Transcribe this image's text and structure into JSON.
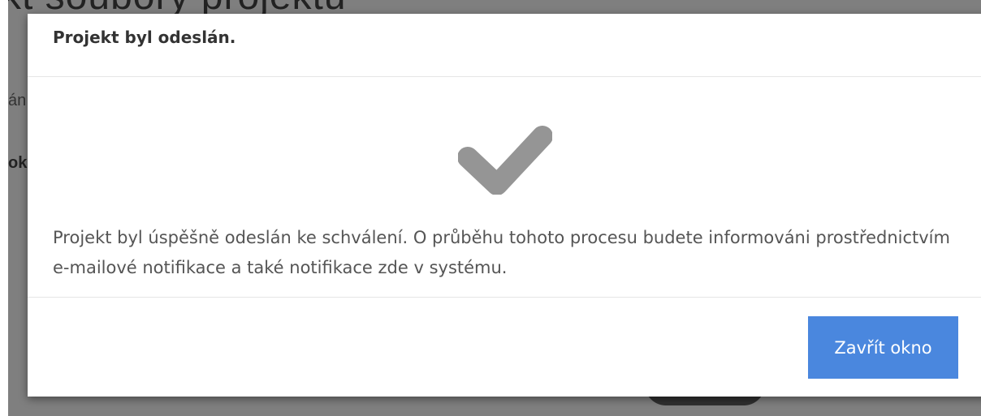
{
  "background_page": {
    "title_fragment": "kt soubory projektu",
    "text_fragment_1": "án",
    "text_fragment_2": "ok"
  },
  "modal": {
    "title": "Projekt byl odeslán.",
    "icon": "checkmark-icon",
    "message": "Projekt byl úspěšně odeslán ke schválení. O průběhu tohoto procesu budete informováni prostřednictvím e-mailové notifikace a také notifikace zde v systému.",
    "close_button_label": "Zavřít okno"
  },
  "colors": {
    "accent": "#4a87de",
    "icon": "#959595",
    "overlay": "#7f7f7f"
  }
}
